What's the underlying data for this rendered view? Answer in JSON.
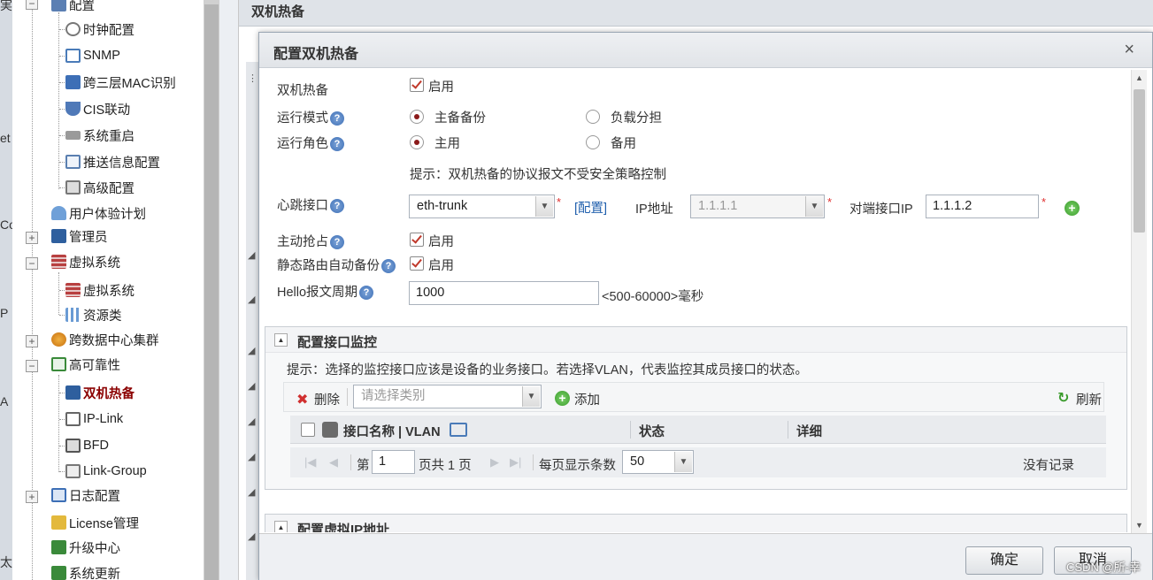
{
  "sidebar": {
    "items": [
      {
        "label": "配置",
        "icon": "config-icon"
      },
      {
        "label": "时钟配置",
        "icon": "clock-icon"
      },
      {
        "label": "SNMP",
        "icon": "network-icon"
      },
      {
        "label": "跨三层MAC识别",
        "icon": "monitor-icon"
      },
      {
        "label": "CIS联动",
        "icon": "shield-icon"
      },
      {
        "label": "系统重启",
        "icon": "restart-icon"
      },
      {
        "label": "推送信息配置",
        "icon": "message-icon"
      },
      {
        "label": "高级配置",
        "icon": "settings-icon"
      },
      {
        "label": "用户体验计划",
        "icon": "user-icon"
      },
      {
        "label": "管理员",
        "icon": "admin-icon"
      },
      {
        "label": "虚拟系统",
        "icon": "firewall-icon"
      },
      {
        "label": "虚拟系统",
        "icon": "firewall-icon"
      },
      {
        "label": "资源类",
        "icon": "resource-icon"
      },
      {
        "label": "跨数据中心集群",
        "icon": "cluster-icon"
      },
      {
        "label": "高可靠性",
        "icon": "reliability-icon"
      },
      {
        "label": "双机热备",
        "icon": "hot-standby-icon"
      },
      {
        "label": "IP-Link",
        "icon": "ip-link-icon"
      },
      {
        "label": "BFD",
        "icon": "bfd-icon"
      },
      {
        "label": "Link-Group",
        "icon": "link-group-icon"
      },
      {
        "label": "日志配置",
        "icon": "log-icon"
      },
      {
        "label": "License管理",
        "icon": "license-icon"
      },
      {
        "label": "升级中心",
        "icon": "upgrade-icon"
      },
      {
        "label": "系统更新",
        "icon": "update-icon"
      }
    ]
  },
  "edge_glyphs": [
    "実",
    "et",
    "Co",
    "P",
    "A",
    "太"
  ],
  "page": {
    "title": "双机热备"
  },
  "dialog": {
    "title": "配置双机热备",
    "close": "×",
    "hot_standby": {
      "label": "双机热备",
      "checkbox_label": "启用"
    },
    "run_mode": {
      "label": "运行模式",
      "option1": "主备备份",
      "option2": "负载分担"
    },
    "run_role": {
      "label": "运行角色",
      "option1": "主用",
      "option2": "备用"
    },
    "tip": "提示：双机热备的协议报文不受安全策略控制",
    "heartbeat": {
      "label": "心跳接口",
      "interface_value": "eth-trunk",
      "config_link": "[配置]",
      "ip_label": "IP地址",
      "ip_value": "1.1.1.1",
      "peer_ip_label": "对端接口IP",
      "peer_ip_value": "1.1.1.2"
    },
    "preempt": {
      "label": "主动抢占",
      "checkbox_label": "启用"
    },
    "static_route": {
      "label": "静态路由自动备份",
      "checkbox_label": "启用"
    },
    "hello": {
      "label": "Hello报文周期",
      "value": "1000",
      "unit": "<500-60000>毫秒"
    },
    "help_glyph": "?",
    "required_mark": "*",
    "monitor_section": {
      "title": "配置接口监控",
      "tip": "提示：选择的监控接口应该是设备的业务接口。若选择VLAN，代表监控其成员接口的状态。",
      "delete_label": "删除",
      "select_placeholder": "请选择类别",
      "add_label": "添加",
      "refresh_label": "刷新",
      "columns": [
        "接口名称 | VLAN",
        "状态",
        "详细"
      ],
      "pager": {
        "page_prefix": "第",
        "page_value": "1",
        "page_suffix": "页共 1 页",
        "page_size_label": "每页显示条数",
        "page_size_value": "50",
        "no_records": "没有记录"
      }
    },
    "vip_section": {
      "title": "配置虚拟IP地址"
    },
    "buttons": {
      "ok": "确定",
      "cancel": "取消"
    }
  },
  "watermark": "CSDN @所-幸"
}
